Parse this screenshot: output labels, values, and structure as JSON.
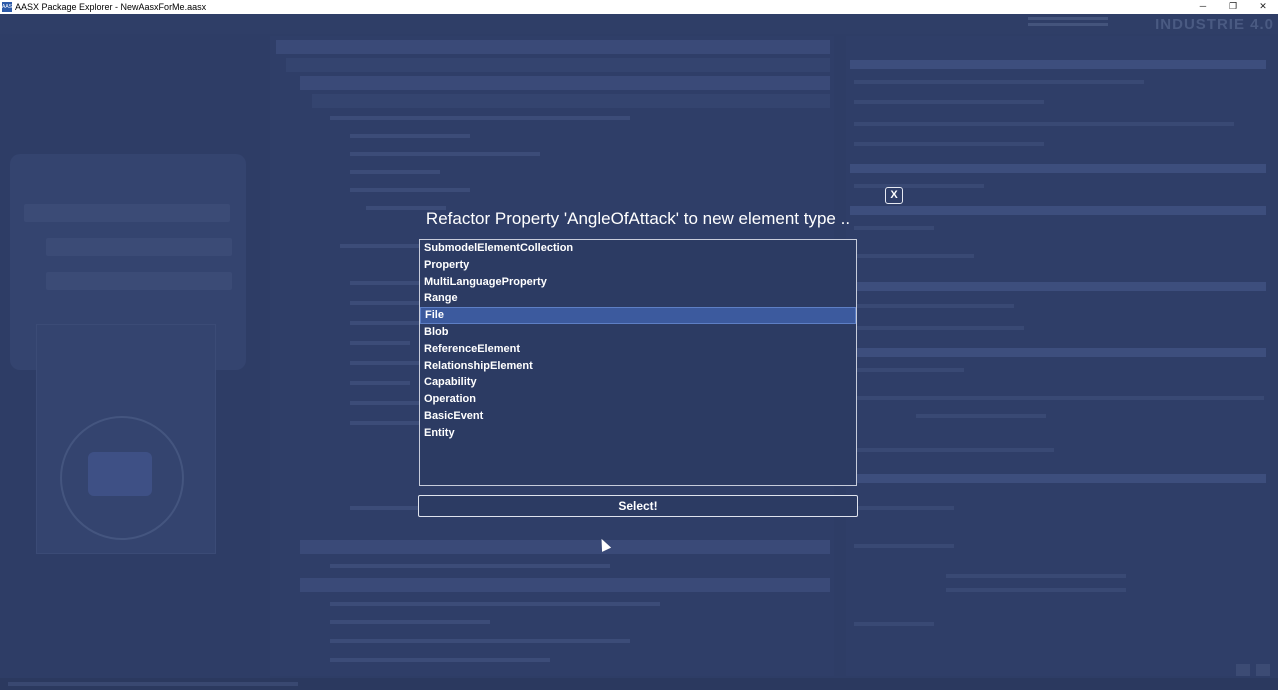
{
  "window": {
    "title": "AASX Package Explorer - NewAasxForMe.aasx",
    "icon": "aasx-app-icon",
    "controls": [
      "─",
      "❐",
      "✕"
    ]
  },
  "background": {
    "logo_text": "INDUSTRIE 4.0"
  },
  "dialog": {
    "close_label": "X",
    "title": "Refactor Property 'AngleOfAttack' to new element type ..",
    "items": [
      "SubmodelElementCollection",
      "Property",
      "MultiLanguageProperty",
      "Range",
      "File",
      "Blob",
      "ReferenceElement",
      "RelationshipElement",
      "Capability",
      "Operation",
      "BasicEvent",
      "Entity"
    ],
    "selected_index": 4,
    "select_label": "Select!"
  },
  "colors": {
    "overlay_bg": "#2c3b63",
    "selection": "#3c5a9e",
    "text": "#ffffff"
  }
}
